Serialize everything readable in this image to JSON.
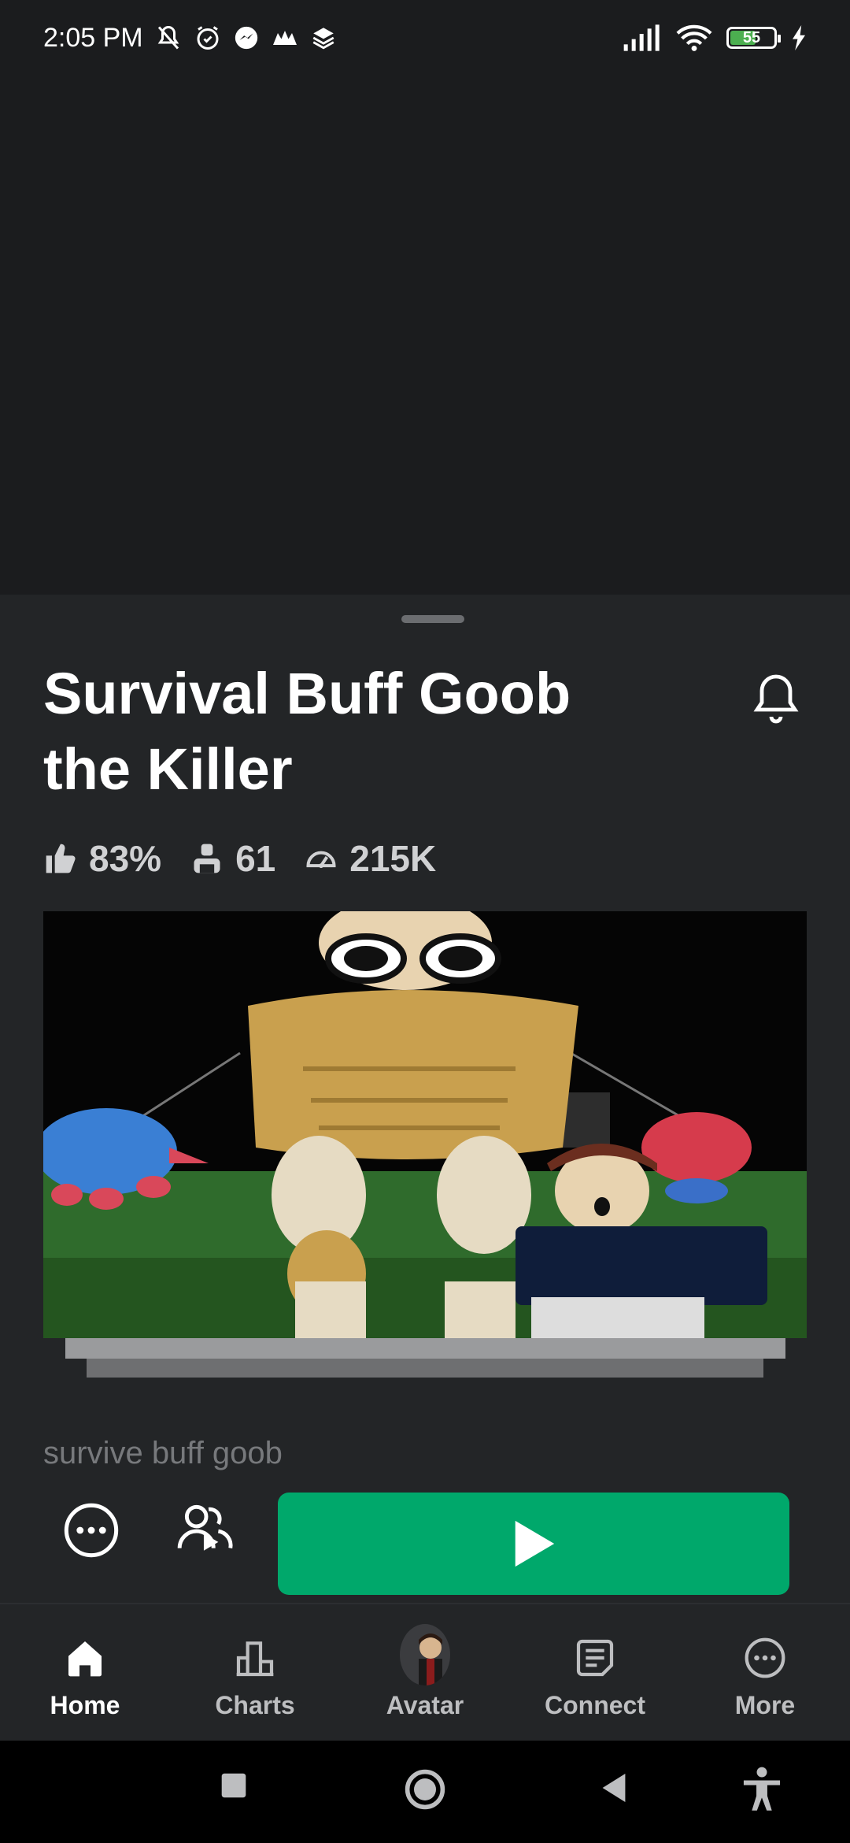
{
  "status_bar": {
    "time": "2:05 PM",
    "battery": "55"
  },
  "game": {
    "title": "Survival Buff Goob the Killer",
    "stats": {
      "rating": "83%",
      "players": "61",
      "visits": "215K"
    },
    "description": "survive buff goob"
  },
  "bottom_nav": {
    "items": [
      {
        "label": "Home",
        "icon": "home-icon"
      },
      {
        "label": "Charts",
        "icon": "charts-icon"
      },
      {
        "label": "Avatar",
        "icon": "avatar"
      },
      {
        "label": "Connect",
        "icon": "connect-icon"
      },
      {
        "label": "More",
        "icon": "more-icon"
      }
    ],
    "active": "Home"
  },
  "colors": {
    "play_green": "#00a86b",
    "sheet_bg": "#232527",
    "page_bg": "#1b1c1e"
  }
}
